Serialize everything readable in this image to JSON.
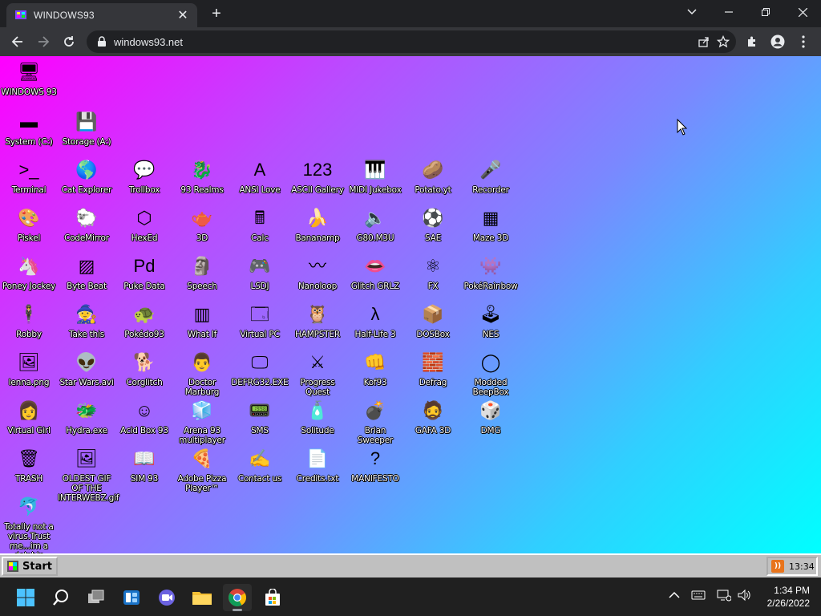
{
  "browser": {
    "tab_title": "WINDOWS93",
    "url": "windows93.net",
    "tab_close": "✕",
    "new_tab": "+"
  },
  "desktop": {
    "icons": [
      {
        "label": "WINDOWS 93",
        "glyph": "🖥"
      },
      {
        "label": "System (C:)",
        "glyph": "▬"
      },
      {
        "label": "Storage (A:)",
        "glyph": "💾"
      },
      {
        "label": "Terminal",
        "glyph": ">_"
      },
      {
        "label": "Cat Explorer",
        "glyph": "🌎"
      },
      {
        "label": "Trollbox",
        "glyph": "💬"
      },
      {
        "label": "93 Realms",
        "glyph": "🐉"
      },
      {
        "label": "ANSI Love",
        "glyph": "A"
      },
      {
        "label": "ASCII Gallery",
        "glyph": "123"
      },
      {
        "label": "MIDI Jukebox",
        "glyph": "🎹"
      },
      {
        "label": "Potato.yt",
        "glyph": "🥔"
      },
      {
        "label": "Recorder",
        "glyph": "🎤"
      },
      {
        "label": "Piskel",
        "glyph": "🎨"
      },
      {
        "label": "CodeMirror",
        "glyph": "🐑"
      },
      {
        "label": "HexEd",
        "glyph": "⬡"
      },
      {
        "label": "3D",
        "glyph": "🫖"
      },
      {
        "label": "Calc",
        "glyph": "🖩"
      },
      {
        "label": "Bananamp",
        "glyph": "🍌"
      },
      {
        "label": "G80.M3U",
        "glyph": "🔈"
      },
      {
        "label": "SAE",
        "glyph": "⚽"
      },
      {
        "label": "Maze 3D",
        "glyph": "▦"
      },
      {
        "label": "Poney Jockey",
        "glyph": "🦄"
      },
      {
        "label": "Byte Beat",
        "glyph": "▨"
      },
      {
        "label": "Puke Data",
        "glyph": "Pd"
      },
      {
        "label": "Speech",
        "glyph": "🗿"
      },
      {
        "label": "LSDJ",
        "glyph": "🎮"
      },
      {
        "label": "Nanoloop",
        "glyph": "〰"
      },
      {
        "label": "Glitch GRLZ",
        "glyph": "👄"
      },
      {
        "label": "FX",
        "glyph": "⚛"
      },
      {
        "label": "PokéRainbow",
        "glyph": "👾"
      },
      {
        "label": "Robby",
        "glyph": "🕴"
      },
      {
        "label": "Take this",
        "glyph": "🧙"
      },
      {
        "label": "Pokédo93",
        "glyph": "🐢"
      },
      {
        "label": "What If",
        "glyph": "▥"
      },
      {
        "label": "Virtual PC",
        "glyph": "🗔"
      },
      {
        "label": "HAMPSTER",
        "glyph": "🦉"
      },
      {
        "label": "Half-Life 3",
        "glyph": "λ"
      },
      {
        "label": "DOSBox",
        "glyph": "📦"
      },
      {
        "label": "NES",
        "glyph": "🕹"
      },
      {
        "label": "lenna.png",
        "glyph": "🖼"
      },
      {
        "label": "Star Wars.avi",
        "glyph": "👽"
      },
      {
        "label": "Corglitch",
        "glyph": "🐕"
      },
      {
        "label": "Doctor Marburg",
        "glyph": "👨"
      },
      {
        "label": "DEFRG32.EXE",
        "glyph": "🖵"
      },
      {
        "label": "Progress Quest",
        "glyph": "⚔"
      },
      {
        "label": "Kof93",
        "glyph": "👊"
      },
      {
        "label": "Defrag",
        "glyph": "🧱"
      },
      {
        "label": "Modded BeepBox",
        "glyph": "◯"
      },
      {
        "label": "Virtual Girl",
        "glyph": "👩"
      },
      {
        "label": "Hydra.exe",
        "glyph": "🐲"
      },
      {
        "label": "Acid Box 93",
        "glyph": "☺"
      },
      {
        "label": "Arena 93 multiplayer",
        "glyph": "🧊"
      },
      {
        "label": "SMS",
        "glyph": "📟"
      },
      {
        "label": "Solitude",
        "glyph": "🧴"
      },
      {
        "label": "Brian Sweeper",
        "glyph": "💣"
      },
      {
        "label": "GAFA 3D",
        "glyph": "🧔"
      },
      {
        "label": "DMG",
        "glyph": "🎲"
      },
      {
        "label": "TRASH",
        "glyph": "🗑"
      },
      {
        "label": "OLDEST GIF OF THE INTERWEBZ.gif",
        "glyph": "🖼"
      },
      {
        "label": "SIM 93",
        "glyph": "📖"
      },
      {
        "label": "Adobe Pizza Player™",
        "glyph": "🍕"
      },
      {
        "label": "Contact us",
        "glyph": "✍"
      },
      {
        "label": "Credits.txt",
        "glyph": "📄"
      },
      {
        "label": "MANIFESTO",
        "glyph": "?"
      },
      {
        "label": "Totally not a virus.Trust me...im a dolphin",
        "glyph": "🐬"
      }
    ]
  },
  "win93_taskbar": {
    "start_label": "Start",
    "time": "13:34",
    "rss_label": "))"
  },
  "win11_taskbar": {
    "time": "1:34 PM",
    "date": "2/26/2022"
  }
}
